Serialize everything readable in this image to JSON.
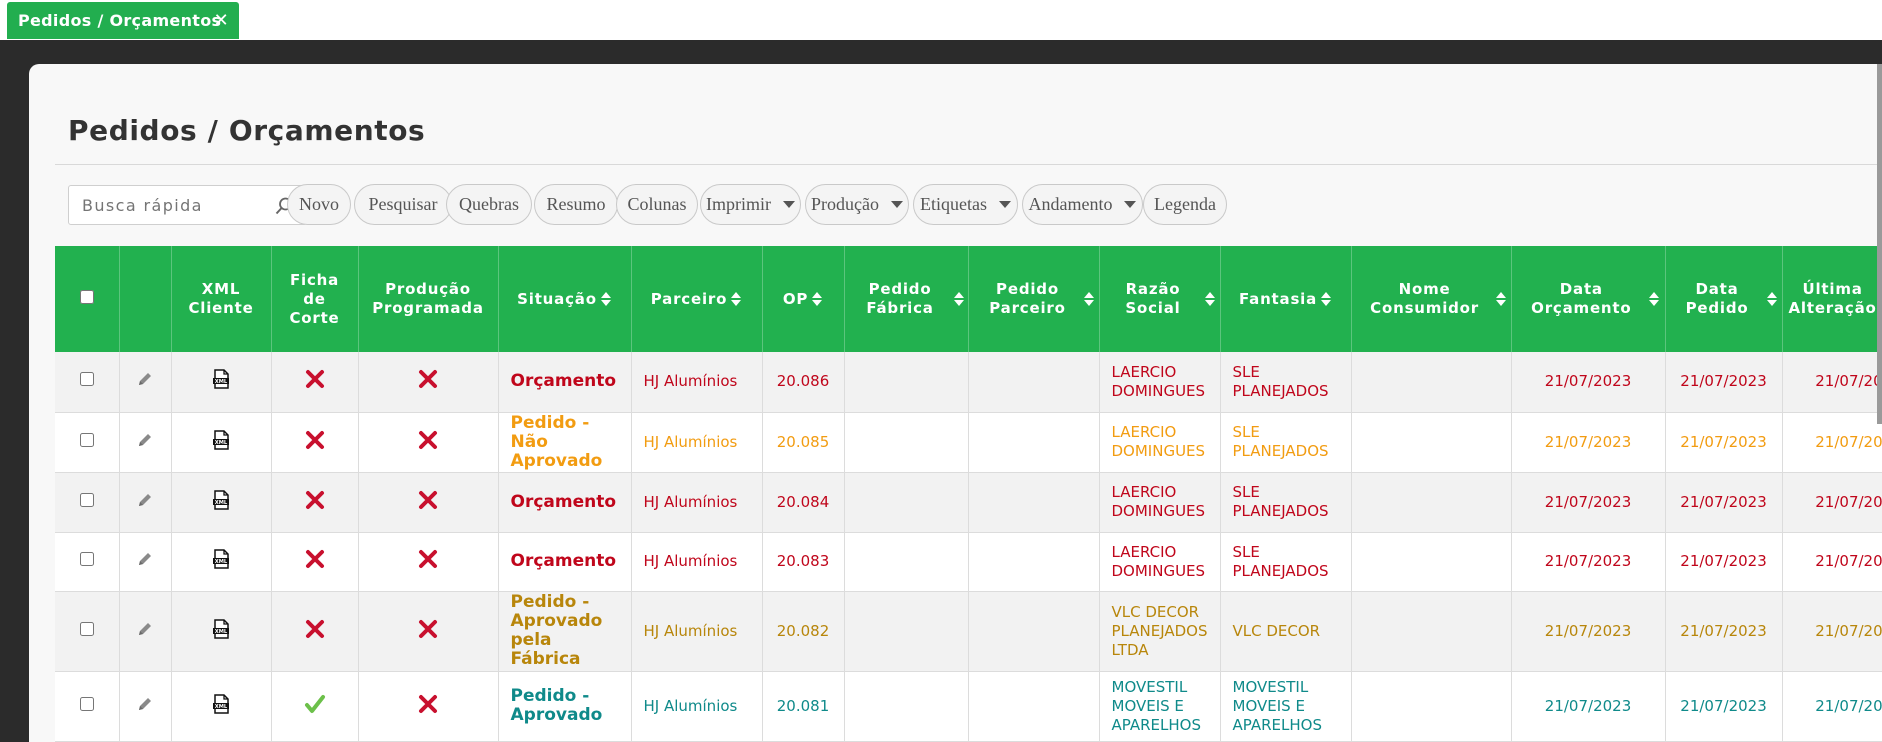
{
  "tab": {
    "label": "Pedidos / Orçamentos",
    "close": "✕"
  },
  "page": {
    "title": "Pedidos / Orçamentos"
  },
  "search": {
    "placeholder": "Busca rápida"
  },
  "toolbar": [
    {
      "label": "Novo",
      "dropdown": false
    },
    {
      "label": "Pesquisar",
      "dropdown": false
    },
    {
      "label": "Quebras",
      "dropdown": false
    },
    {
      "label": "Resumo",
      "dropdown": false
    },
    {
      "label": "Colunas",
      "dropdown": false
    },
    {
      "label": "Imprimir",
      "dropdown": true
    },
    {
      "label": "Produção",
      "dropdown": true
    },
    {
      "label": "Etiquetas",
      "dropdown": true
    },
    {
      "label": "Andamento",
      "dropdown": true
    },
    {
      "label": "Legenda",
      "dropdown": false
    }
  ],
  "columns": [
    {
      "key": "select",
      "label": "",
      "sortable": false
    },
    {
      "key": "edit",
      "label": "",
      "sortable": false
    },
    {
      "key": "xml",
      "label": "XML Cliente",
      "sortable": false
    },
    {
      "key": "ficha",
      "label": "Ficha de Corte",
      "sortable": false
    },
    {
      "key": "producao",
      "label": "Produção Programada",
      "sortable": false
    },
    {
      "key": "situacao",
      "label": "Situação",
      "sortable": true
    },
    {
      "key": "parceiro",
      "label": "Parceiro",
      "sortable": true
    },
    {
      "key": "op",
      "label": "OP",
      "sortable": true
    },
    {
      "key": "pedido_fabrica",
      "label": "Pedido Fábrica",
      "sortable": true
    },
    {
      "key": "pedido_parceiro",
      "label": "Pedido Parceiro",
      "sortable": true
    },
    {
      "key": "razao",
      "label": "Razão Social",
      "sortable": true
    },
    {
      "key": "fantasia",
      "label": "Fantasia",
      "sortable": true
    },
    {
      "key": "consumidor",
      "label": "Nome Consumidor",
      "sortable": true
    },
    {
      "key": "data_orc",
      "label": "Data Orçamento",
      "sortable": true
    },
    {
      "key": "data_ped",
      "label": "Data Pedido",
      "sortable": true
    },
    {
      "key": "ultima",
      "label": "Última Alteração",
      "sortable": false
    }
  ],
  "status_colors": {
    "red": "#c0061b",
    "orange": "#f29c11",
    "gold": "#b8860b",
    "teal": "#0f8a8a",
    "header_green": "#22b14f"
  },
  "rows": [
    {
      "color": "red",
      "ficha": false,
      "producao": false,
      "situacao": "Orçamento",
      "parceiro": "HJ Alumínios",
      "op": "20.086",
      "pedido_fabrica": "",
      "pedido_parceiro": "",
      "razao": "LAERCIO DOMINGUES",
      "fantasia": "SLE PLANEJADOS",
      "consumidor": "",
      "data_orc": "21/07/2023",
      "data_ped": "21/07/2023",
      "ultima": "21/07/20"
    },
    {
      "color": "orange",
      "ficha": false,
      "producao": false,
      "situacao": "Pedido - Não Aprovado",
      "parceiro": "HJ Alumínios",
      "op": "20.085",
      "pedido_fabrica": "",
      "pedido_parceiro": "",
      "razao": "LAERCIO DOMINGUES",
      "fantasia": "SLE PLANEJADOS",
      "consumidor": "",
      "data_orc": "21/07/2023",
      "data_ped": "21/07/2023",
      "ultima": "21/07/20"
    },
    {
      "color": "red",
      "ficha": false,
      "producao": false,
      "situacao": "Orçamento",
      "parceiro": "HJ Alumínios",
      "op": "20.084",
      "pedido_fabrica": "",
      "pedido_parceiro": "",
      "razao": "LAERCIO DOMINGUES",
      "fantasia": "SLE PLANEJADOS",
      "consumidor": "",
      "data_orc": "21/07/2023",
      "data_ped": "21/07/2023",
      "ultima": "21/07/20"
    },
    {
      "color": "red",
      "ficha": false,
      "producao": false,
      "situacao": "Orçamento",
      "parceiro": "HJ Alumínios",
      "op": "20.083",
      "pedido_fabrica": "",
      "pedido_parceiro": "",
      "razao": "LAERCIO DOMINGUES",
      "fantasia": "SLE PLANEJADOS",
      "consumidor": "",
      "data_orc": "21/07/2023",
      "data_ped": "21/07/2023",
      "ultima": "21/07/20"
    },
    {
      "color": "gold",
      "ficha": false,
      "producao": false,
      "situacao": "Pedido - Aprovado pela Fábrica",
      "parceiro": "HJ Alumínios",
      "op": "20.082",
      "pedido_fabrica": "",
      "pedido_parceiro": "",
      "razao": "VLC DECOR PLANEJADOS LTDA",
      "fantasia": "VLC DECOR",
      "consumidor": "",
      "data_orc": "21/07/2023",
      "data_ped": "21/07/2023",
      "ultima": "21/07/20"
    },
    {
      "color": "teal",
      "ficha": true,
      "producao": false,
      "situacao": "Pedido - Aprovado",
      "parceiro": "HJ Alumínios",
      "op": "20.081",
      "pedido_fabrica": "",
      "pedido_parceiro": "",
      "razao": "MOVESTIL MOVEIS E APARELHOS",
      "fantasia": "MOVESTIL MOVEIS E APARELHOS",
      "consumidor": "",
      "data_orc": "21/07/2023",
      "data_ped": "21/07/2023",
      "ultima": "21/07/20"
    }
  ]
}
